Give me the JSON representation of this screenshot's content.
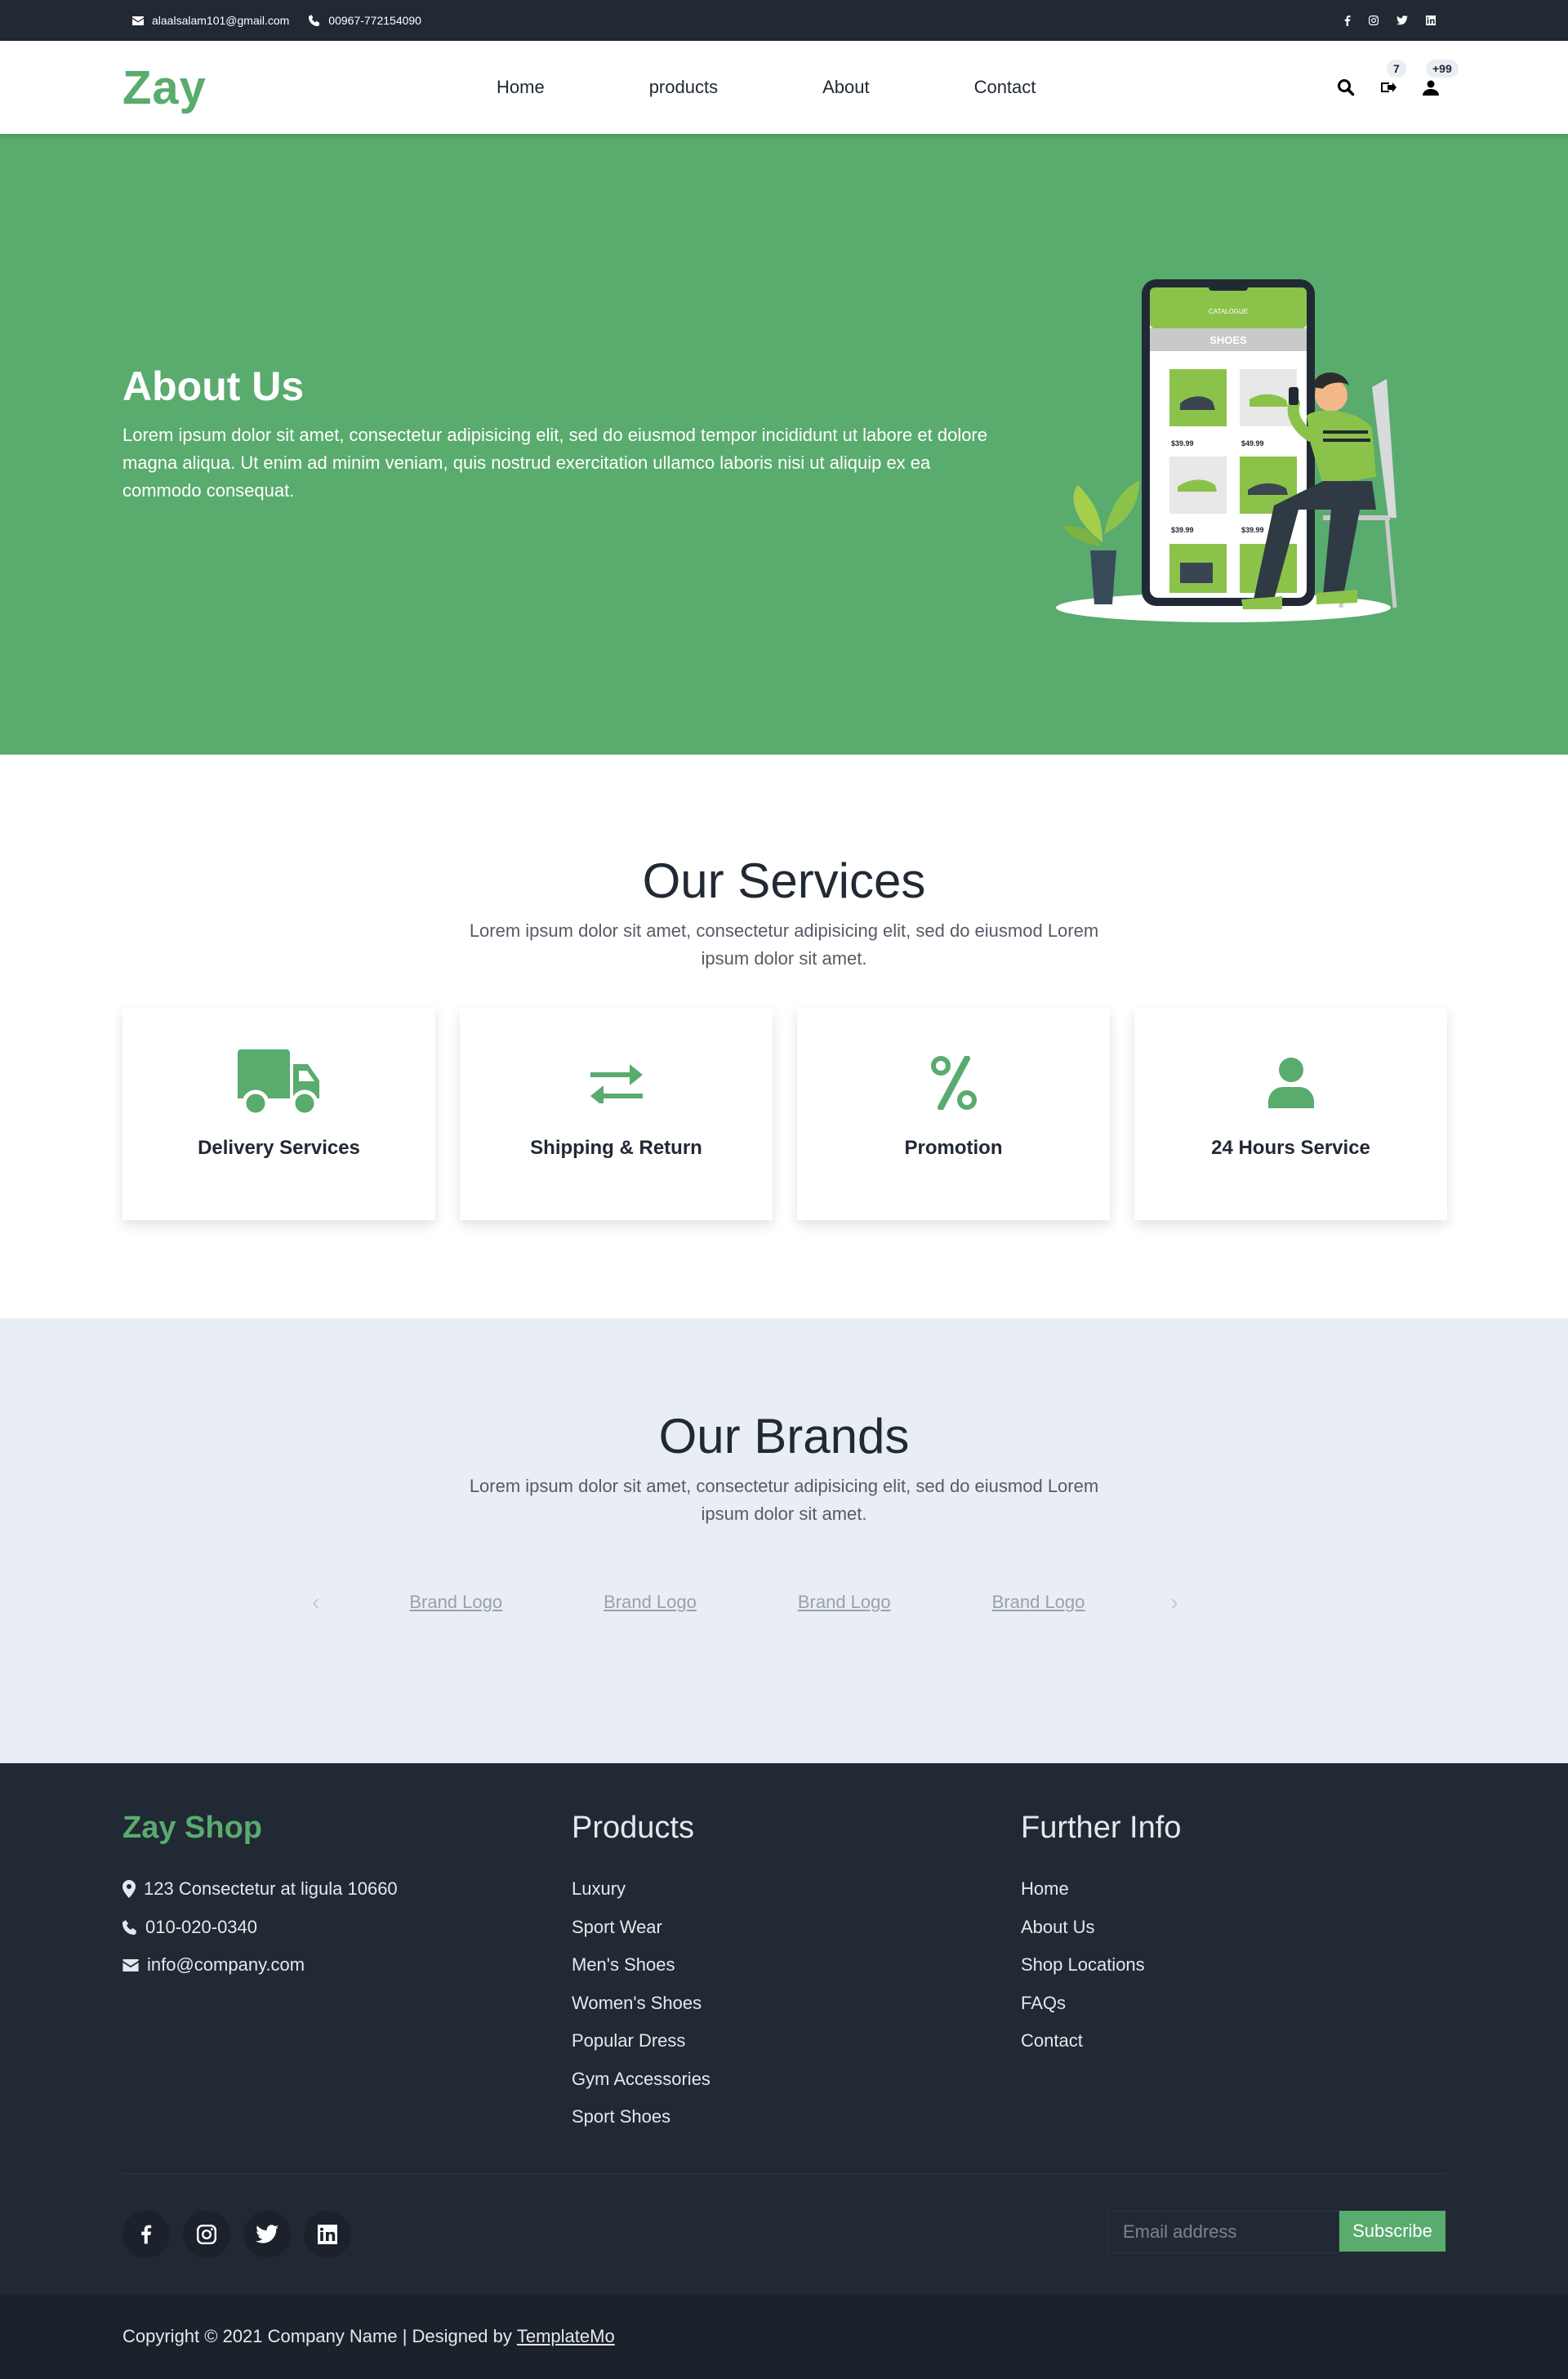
{
  "topbar": {
    "email": "alaalsalam101@gmail.com",
    "phone": "00967-772154090",
    "socials": [
      "facebook-icon",
      "instagram-icon",
      "twitter-icon",
      "linkedin-icon"
    ]
  },
  "navbar": {
    "brand": "Zay",
    "links": [
      "Home",
      "products",
      "About",
      "Contact"
    ],
    "cart_count": "7",
    "user_count": "+99"
  },
  "hero": {
    "title": "About Us",
    "text": "Lorem ipsum dolor sit amet, consectetur adipisicing elit, sed do eiusmod tempor incididunt ut labore et dolore magna aliqua. Ut enim ad minim veniam, quis nostrud exercitation ullamco laboris nisi ut aliquip ex ea commodo consequat.",
    "phone_screen": {
      "header": "CATALOGUE",
      "category": "SHOES",
      "prices": [
        "$39.99",
        "$49.99",
        "$39.99",
        "$39.99"
      ]
    }
  },
  "services": {
    "title": "Our Services",
    "description": "Lorem ipsum dolor sit amet, consectetur adipisicing elit, sed do eiusmod Lorem ipsum dolor sit amet.",
    "cards": [
      {
        "label": "Delivery Services",
        "icon": "truck-icon"
      },
      {
        "label": "Shipping & Return",
        "icon": "exchange-icon"
      },
      {
        "label": "Promotion",
        "icon": "percent-icon"
      },
      {
        "label": "24 Hours Service",
        "icon": "user-icon"
      }
    ]
  },
  "brands": {
    "title": "Our Brands",
    "description": "Lorem ipsum dolor sit amet, consectetur adipisicing elit, sed do eiusmod Lorem ipsum dolor sit amet.",
    "logos": [
      "Brand Logo",
      "Brand Logo",
      "Brand Logo",
      "Brand Logo"
    ],
    "prev": "‹",
    "next": "›"
  },
  "footer": {
    "shop_title": "Zay Shop",
    "contact": [
      "123 Consectetur at ligula 10660",
      "010-020-0340",
      "info@company.com"
    ],
    "products_title": "Products",
    "products": [
      "Luxury",
      "Sport Wear",
      "Men's Shoes",
      "Women's Shoes",
      "Popular Dress",
      "Gym Accessories",
      "Sport Shoes"
    ],
    "info_title": "Further Info",
    "info": [
      "Home",
      "About Us",
      "Shop Locations",
      "FAQs",
      "Contact"
    ],
    "email_placeholder": "Email address",
    "subscribe_label": "Subscribe"
  },
  "copyright": {
    "text": "Copyright © 2021 Company Name | Designed by",
    "link": "TemplateMo"
  },
  "colors": {
    "accent": "#59ab6e",
    "dark": "#212934",
    "light_bg": "#e9eef4"
  }
}
